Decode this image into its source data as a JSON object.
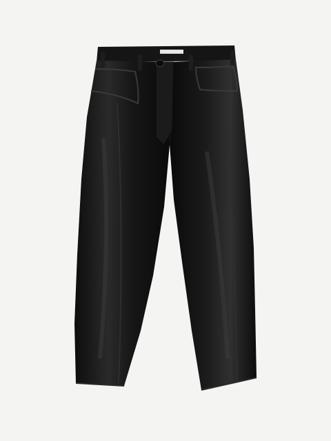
{
  "image": {
    "subject": "pants-icon",
    "colors": {
      "background": "#f4f4f2",
      "garment": "#141414",
      "garment_highlight": "#3a3a3a",
      "label": "#e6e6e6"
    }
  }
}
